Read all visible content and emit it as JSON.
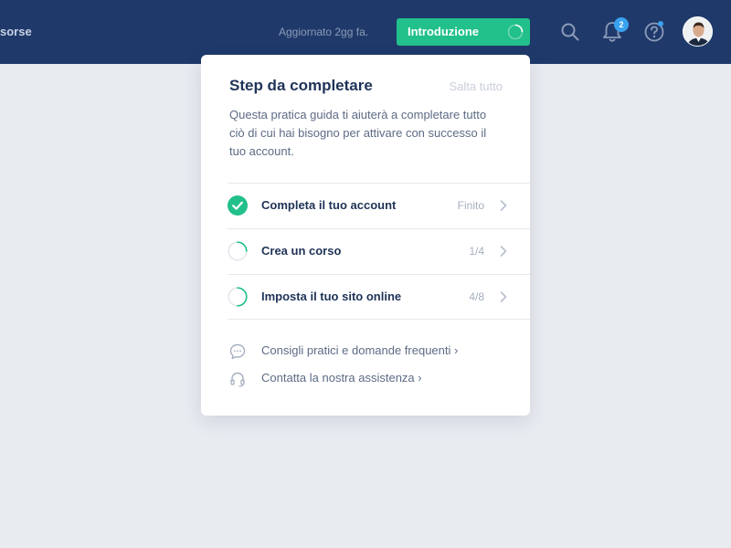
{
  "header": {
    "nav_partial_label": "sorse",
    "updated_text": "Aggiornato 2gg fa.",
    "intro_button_label": "Introduzione",
    "notification_count": "2",
    "search_icon": "search-icon",
    "bell_icon": "bell-icon",
    "help_icon": "help-icon"
  },
  "panel": {
    "title": "Step da completare",
    "skip_label": "Salta tutto",
    "description": "Questa pratica guida ti aiuterà a completare tutto ciò di cui hai bisogno per attivare con successo il tuo account.",
    "steps": [
      {
        "label": "Completa il tuo account",
        "status": "Finito",
        "progress": 1.0,
        "icon": "check-circle-icon"
      },
      {
        "label": "Crea un corso",
        "status": "1/4",
        "progress": 0.25,
        "icon": "progress-ring-icon"
      },
      {
        "label": "Imposta il tuo sito online",
        "status": "4/8",
        "progress": 0.5,
        "icon": "progress-ring-icon"
      }
    ],
    "links": [
      {
        "label": "Consigli pratici e domande frequenti ›",
        "icon": "chat-bubble-icon"
      },
      {
        "label": "Contatta la nostra assistenza ›",
        "icon": "headset-icon"
      }
    ]
  },
  "colors": {
    "topbar": "#1f3a6a",
    "accent_green": "#22c08a",
    "badge_blue": "#3aa1ee",
    "background": "#e8ebf0"
  }
}
